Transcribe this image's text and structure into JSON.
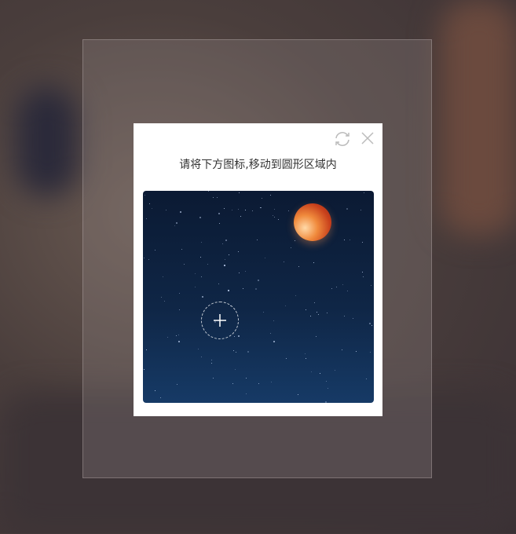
{
  "dialog": {
    "instruction": "请将下方图标,移动到圆形区域内",
    "refresh_icon": "refresh-icon",
    "close_icon": "close-icon"
  },
  "puzzle": {
    "target_icon": "plus-icon",
    "draggable_icon": "moon"
  }
}
